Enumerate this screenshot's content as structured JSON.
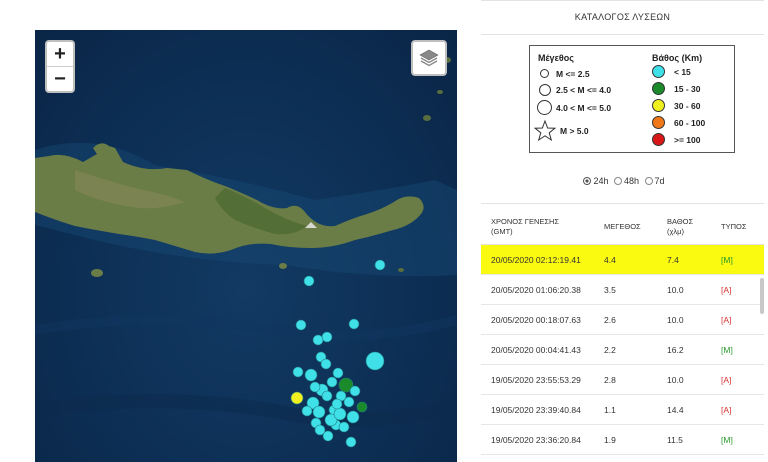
{
  "map": {
    "zoom_in": "+",
    "zoom_out": "−",
    "colors": {
      "sea": "#0d2f55",
      "land": "#6b7d46",
      "shallow": "#16466f"
    }
  },
  "panel": {
    "title": "ΚΑΤΑΛΟΓΟΣ ΛΥΣΕΩΝ",
    "legend": {
      "magnitude_header": "Μέγεθος",
      "depth_header": "Βάθος (Km)",
      "magnitude_rows": [
        "M <= 2.5",
        "2.5 < M <= 4.0",
        "4.0 < M <= 5.0",
        "M > 5.0"
      ],
      "depth_rows": [
        {
          "label": "< 15",
          "color": "#40e0e8"
        },
        {
          "label": "15 - 30",
          "color": "#1a8a2a"
        },
        {
          "label": "30 - 60",
          "color": "#f0f020"
        },
        {
          "label": "60 - 100",
          "color": "#f07818"
        },
        {
          "label": ">= 100",
          "color": "#d81818"
        }
      ]
    },
    "radios": [
      {
        "label": "24h",
        "selected": true
      },
      {
        "label": "48h",
        "selected": false
      },
      {
        "label": "7d",
        "selected": false
      }
    ],
    "table": {
      "headers": {
        "time_1": "ΧΡΟΝΟΣ ΓΕΝΕΣΗΣ",
        "time_2": "(GMT)",
        "mag": "ΜΕΓΕΘΟΣ",
        "depth_1": "ΒΑΘΟΣ",
        "depth_2": "(χλμ)",
        "type": "ΤΥΠΟΣ"
      },
      "rows": [
        {
          "time": "20/05/2020 02:12:19.41",
          "mag": "4.4",
          "depth": "7.4",
          "type": "[M]",
          "type_color": "#2a9a2a",
          "highlight": true
        },
        {
          "time": "20/05/2020 01:06:20.38",
          "mag": "3.5",
          "depth": "10.0",
          "type": "[A]",
          "type_color": "#d83030",
          "highlight": false
        },
        {
          "time": "20/05/2020 00:18:07.63",
          "mag": "2.6",
          "depth": "10.0",
          "type": "[A]",
          "type_color": "#d83030",
          "highlight": false
        },
        {
          "time": "20/05/2020 00:04:41.43",
          "mag": "2.2",
          "depth": "16.2",
          "type": "[M]",
          "type_color": "#2a9a2a",
          "highlight": false
        },
        {
          "time": "19/05/2020 23:55:53.29",
          "mag": "2.8",
          "depth": "10.0",
          "type": "[A]",
          "type_color": "#d83030",
          "highlight": false
        },
        {
          "time": "19/05/2020 23:39:40.84",
          "mag": "1.1",
          "depth": "14.4",
          "type": "[A]",
          "type_color": "#d83030",
          "highlight": false
        },
        {
          "time": "19/05/2020 23:36:20.84",
          "mag": "1.9",
          "depth": "11.5",
          "type": "[M]",
          "type_color": "#2a9a2a",
          "highlight": false
        }
      ]
    }
  }
}
